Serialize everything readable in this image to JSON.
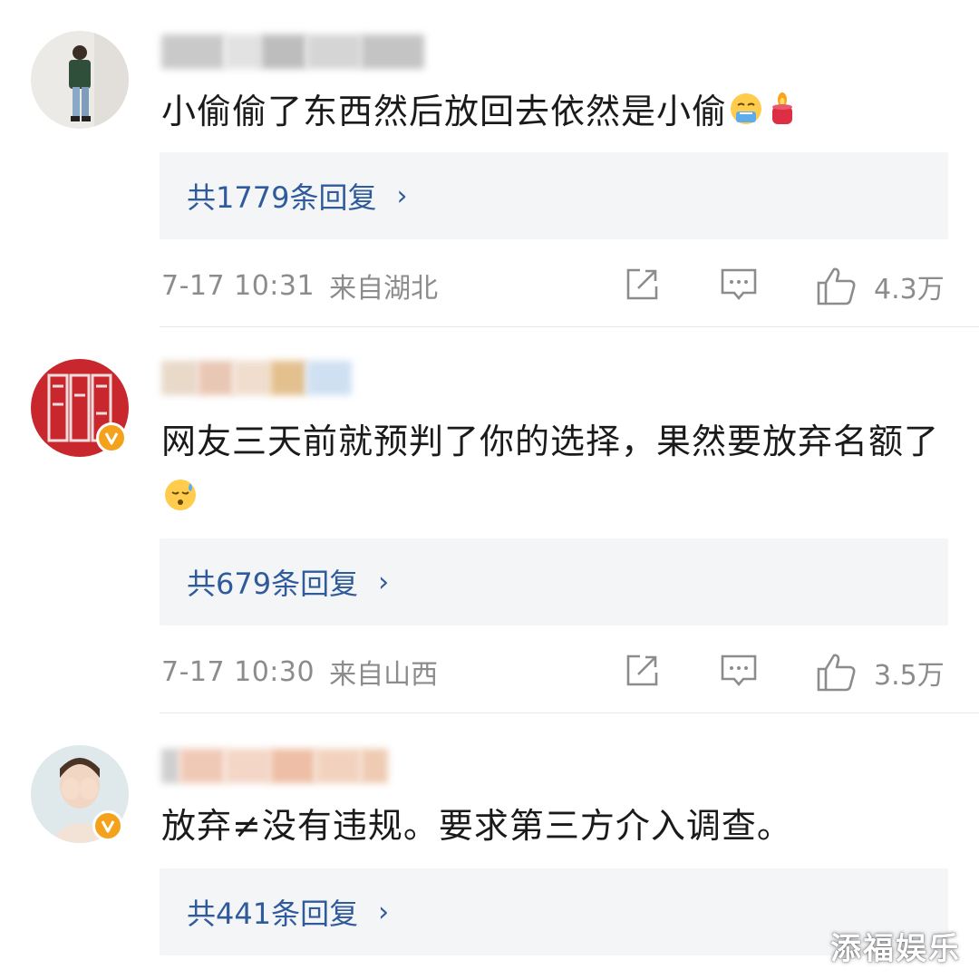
{
  "comments": [
    {
      "text": "小偷偷了东西然后放回去依然是小偷",
      "emoji": [
        "weary-face-emoji",
        "candle-emoji"
      ],
      "replies_label": "共1779条回复",
      "time": "7-17 10:31",
      "location": "来自湖北",
      "likes": "4.3万",
      "verified": false
    },
    {
      "text": "网友三天前就预判了你的选择，果然要放弃名额了",
      "emoji": [
        "sweat-face-emoji"
      ],
      "replies_label": "共679条回复",
      "time": "7-17 10:30",
      "location": "来自山西",
      "likes": "3.5万",
      "verified": true
    },
    {
      "text": "放弃≠没有违规。要求第三方介入调查。",
      "emoji": [],
      "replies_label": "共441条回复",
      "verified": true
    }
  ],
  "icons": {
    "share": "share-icon",
    "comment": "comment-icon",
    "like": "thumbs-up-icon",
    "chevron": "chevron-right-icon",
    "verified": "verified-v-badge-icon"
  },
  "colors": {
    "link": "#2f5a9c",
    "meta": "#8c8c8c",
    "verified": "#f4a21c",
    "reply_bg": "#f4f5f7"
  },
  "chevron_glyph": "›",
  "watermark": "添福娱乐"
}
